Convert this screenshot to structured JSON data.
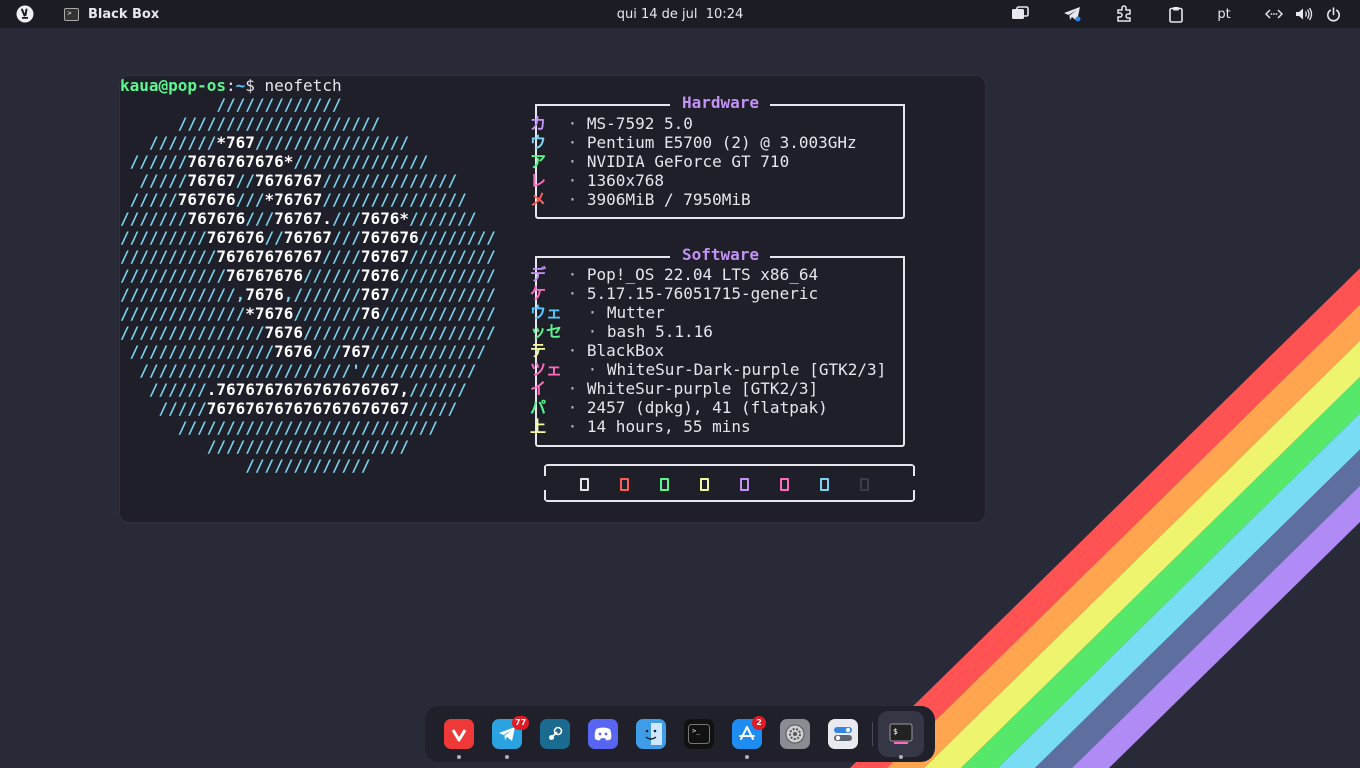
{
  "topbar": {
    "app_name": "Black Box",
    "clock": "qui 14 de jul  10:24",
    "keyboard_layout": "pt",
    "icons": [
      "pop-os-logo-icon",
      "terminal-app-icon",
      "screen-mirror-icon",
      "telegram-tray-icon",
      "extensions-icon",
      "clipboard-icon",
      "network-icon",
      "volume-icon",
      "power-icon"
    ]
  },
  "terminal": {
    "prompt_user": "kaua@pop-os",
    "prompt_sep": ":",
    "prompt_path": "~",
    "prompt_symbol": "$ ",
    "command": "neofetch",
    "logo_lines": [
      [
        "          /////////////"
      ],
      [
        "      /////////////////////"
      ],
      [
        "   ///////",
        "*767",
        "////////////////"
      ],
      [
        " //////",
        "7676767676*",
        "//////////////"
      ],
      [
        "  /////",
        "76767",
        "//",
        "7676767",
        "//////////////"
      ],
      [
        " /////",
        "767676",
        "///",
        "*76767",
        "///////////////"
      ],
      [
        "///////",
        "767676",
        "///",
        "76767.",
        "///",
        "7676*",
        "///////"
      ],
      [
        "/////////",
        "767676",
        "//",
        "76767",
        "///",
        "767676",
        "////////"
      ],
      [
        "//////////",
        "76767676767",
        "////",
        "76767",
        "/////////"
      ],
      [
        "///////////",
        "76767676",
        "//////",
        "7676",
        "//////////"
      ],
      [
        "////////////,",
        "7676",
        ",///////",
        "767",
        "///////////"
      ],
      [
        "/////////////",
        "*7676",
        "///////",
        "76",
        "////////////"
      ],
      [
        "///////////////",
        "7676",
        "////////////////////"
      ],
      [
        " ///////////////",
        "7676",
        "///",
        "767",
        "////////////"
      ],
      [
        "  //////////////////////'////////////"
      ],
      [
        "   //////",
        ".7676767676767676767,",
        "//////"
      ],
      [
        "    /////",
        "767676767676767676767",
        "/////"
      ],
      [
        "      ///////////////////////////"
      ],
      [
        "         /////////////////////"
      ],
      [
        "             /////////////"
      ]
    ],
    "hardware": {
      "title": "Hardware",
      "rows": [
        {
          "key": "カ",
          "value": "MS-7592 5.0",
          "color": "#c292f5"
        },
        {
          "key": "ウ",
          "value": "Pentium E5700 (2) @ 3.003GHz",
          "color": "#7ad3f0"
        },
        {
          "key": "ア",
          "value": "NVIDIA GeForce GT 710",
          "color": "#5af78e"
        },
        {
          "key": "レ",
          "value": "1360x768",
          "color": "#ff6ac1"
        },
        {
          "key": "メ",
          "value": "3906MiB / 7950MiB",
          "color": "#ff5c57"
        }
      ]
    },
    "software": {
      "title": "Software",
      "rows": [
        {
          "key": "デ",
          "value": "Pop!_OS 22.04 LTS x86_64",
          "color": "#c292f5"
        },
        {
          "key": "ケ",
          "value": "5.17.15-76051715-generic",
          "color": "#ff6ac1"
        },
        {
          "key": "ウェ",
          "value": "Mutter",
          "color": "#57c7ff"
        },
        {
          "key": "ッセ",
          "value": "bash 5.1.16",
          "color": "#5af78e"
        },
        {
          "key": "テ",
          "value": "BlackBox",
          "color": "#f3f99d"
        },
        {
          "key": "ツェ",
          "value": "WhiteSur-Dark-purple [GTK2/3]",
          "color": "#ff6ac1"
        },
        {
          "key": "イ",
          "value": "WhiteSur-purple [GTK2/3]",
          "color": "#ff6ac1"
        },
        {
          "key": "パ",
          "value": "2457 (dpkg), 41 (flatpak)",
          "color": "#5af78e"
        },
        {
          "key": "上",
          "value": "14 hours, 55 mins",
          "color": "#f3f99d"
        }
      ]
    },
    "separator": "·",
    "palette": [
      "#e6e6ec",
      "#ff5c57",
      "#5af78e",
      "#f3f99d",
      "#c292f5",
      "#ff6ac1",
      "#7ad3f0",
      "#3a3c4a"
    ]
  },
  "dock": {
    "apps": [
      {
        "name": "vivaldi-icon",
        "color": "#ef3939",
        "running": true
      },
      {
        "name": "telegram-icon",
        "color": "#2aa3e0",
        "running": true,
        "badge": "77"
      },
      {
        "name": "steam-icon",
        "color": "#1b6a8f",
        "running": false
      },
      {
        "name": "discord-icon",
        "color": "#5865f2",
        "running": false
      },
      {
        "name": "finder-icon",
        "color": "#3f9de8",
        "running": false
      },
      {
        "name": "terminal-icon",
        "color": "#111111",
        "running": false
      },
      {
        "name": "app-store-icon",
        "color": "#1e8cf0",
        "running": true,
        "badge": "2"
      },
      {
        "name": "settings-icon",
        "color": "#8a8c94",
        "running": false
      },
      {
        "name": "tweaks-icon",
        "color": "#e8eaf0",
        "running": false
      },
      {
        "name": "blackbox-icon",
        "color": "#3a3c4a",
        "running": true
      }
    ]
  },
  "wallpaper": {
    "stripe_colors": [
      "#ff5353",
      "#ffa54f",
      "#eef46d",
      "#56e86b",
      "#79dcf5",
      "#5d6e9f",
      "#b08af5"
    ]
  }
}
